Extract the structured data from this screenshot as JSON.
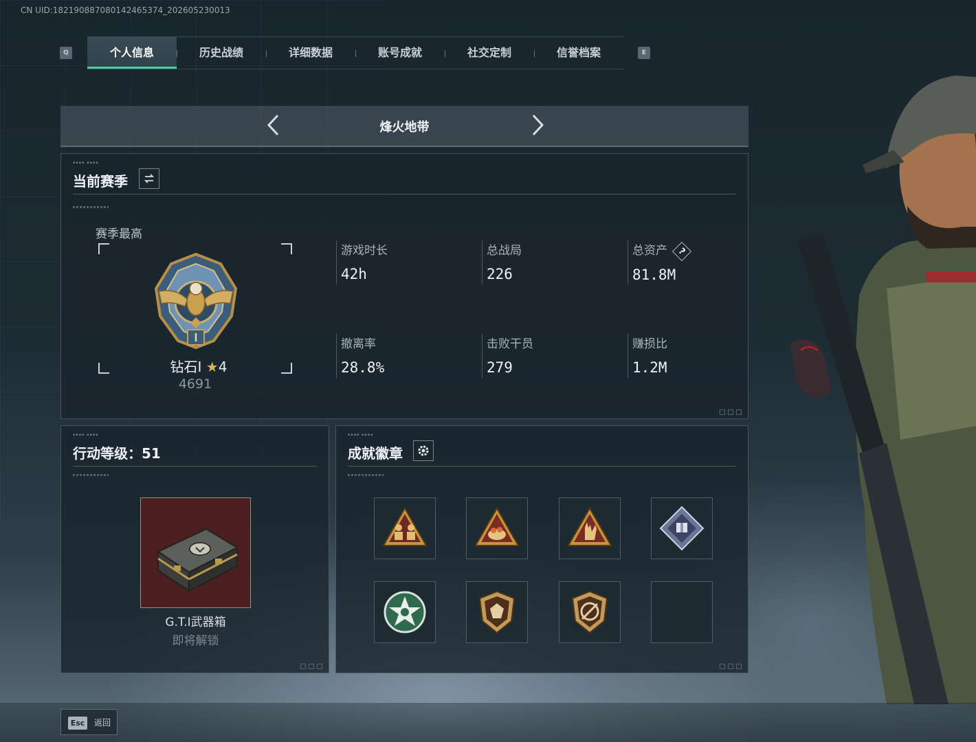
{
  "uid_text": "CN UID:18219088708014246537​4_202605230013",
  "tabs": {
    "q_key": "Q",
    "e_key": "E",
    "items": [
      "个人信息",
      "历史战绩",
      "详细数据",
      "账号成就",
      "社交定制",
      "信誉档案"
    ],
    "active_index": 0
  },
  "mode": {
    "title": "烽火地带"
  },
  "season": {
    "title": "当前赛季",
    "best_label": "赛季最高",
    "rank_name": "钻石I",
    "rank_stars": "4",
    "rank_score": "4691",
    "stats": [
      {
        "label": "游戏时长",
        "value": "42h"
      },
      {
        "label": "总战局",
        "value": "226"
      },
      {
        "label": "总资产",
        "value": "81.8M"
      },
      {
        "label": "撤离率",
        "value": "28.8%"
      },
      {
        "label": "击败干员",
        "value": "279"
      },
      {
        "label": "赚损比",
        "value": "1.2M"
      }
    ],
    "total_assets_help": "?"
  },
  "level": {
    "title": "行动等级：51",
    "reward_name": "G.T.I武器箱",
    "reward_status": "即将解锁"
  },
  "badges": {
    "title": "成就徽章",
    "items": [
      "squad-triangle-badge",
      "fruit-triangle-badge",
      "hand-sign-triangle-badge",
      "diamond-gift-badge",
      "green-star-badge",
      "gem-shield-badge",
      "crossed-shield-badge",
      "empty-slot"
    ]
  },
  "footer": {
    "esc_key": "Esc",
    "back_label": "返回"
  },
  "colors": {
    "accent": "#3fd6a0",
    "panel": "#1a252d",
    "text": "#e6ebee",
    "medal_gold": "#c9a14f",
    "medal_blue": "#4f7fa6"
  }
}
